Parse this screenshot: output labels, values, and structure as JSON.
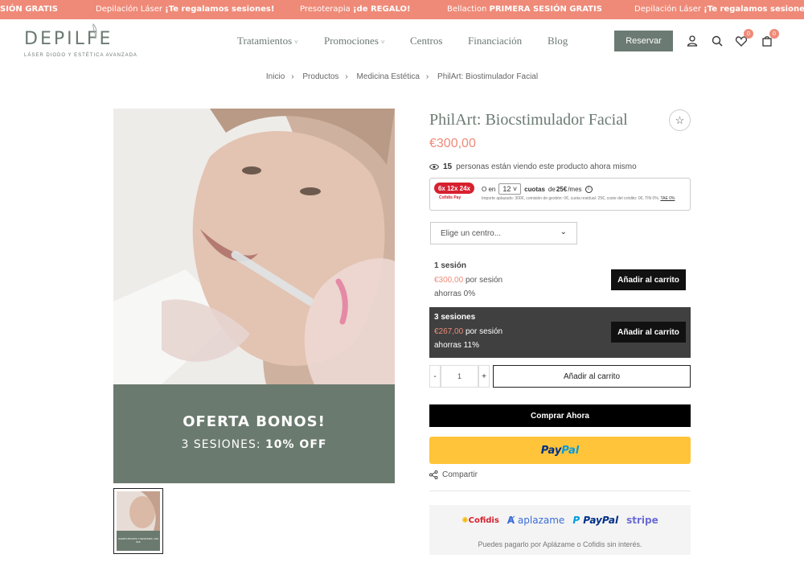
{
  "promo_bar": {
    "items": [
      {
        "text": "SIÓN GRATIS",
        "bold": ""
      },
      {
        "text": "Depilación Láser ",
        "bold": "¡Te regalamos sesiones!"
      },
      {
        "text": "Presoterapia ",
        "bold": "¡de REGALO!"
      },
      {
        "text": "Bellaction ",
        "bold": "PRIMERA SESIÓN GRATIS"
      },
      {
        "text": "Depilación Láser ",
        "bold": "¡Te regalamos sesiones!"
      }
    ]
  },
  "header": {
    "logo_text": "DEPILFE",
    "logo_tagline": "LÁSER DIODO Y ESTÉTICA AVANZADA",
    "nav": [
      "Tratamientos",
      "Promociones",
      "Centros",
      "Financiación",
      "Blog"
    ],
    "reserve_label": "Reservar",
    "wishlist_count": "0",
    "cart_count": "0"
  },
  "breadcrumb": [
    "Inicio",
    "Productos",
    "Medicina Estética",
    "PhilArt: Biostimulador Facial"
  ],
  "product": {
    "title": "PhilArt: Biocstimulador Facial",
    "price": "€300,00",
    "viewing_count": "15",
    "viewing_text": "personas están viendo este producto ahora mismo",
    "image_banner_line1": "OFERTA BONOS!",
    "image_banner_line2": "3 SESIONES: ",
    "image_banner_bold": "10% OFF",
    "thumb_text": "OFERTA BONOS! 3 SESIONES: 10% OFF"
  },
  "cofidis": {
    "badge": "6x 12x 24x",
    "brand": "Cofidis Pay",
    "o_en": "O en",
    "months": "12",
    "cuotas_label": "cuotas",
    "cuotas_de": "de",
    "cuota_amount": "25€",
    "per_month": "/mes",
    "fine_print": "Importe aplazado: 300€, comisión de gestión: 0€, cuota residual: 25€, coste del crédito: 0€, TIN 0%.",
    "tae": "TAE 0%"
  },
  "centro_select": {
    "placeholder": "Elige un centro..."
  },
  "options": [
    {
      "name": "1 sesión",
      "price": "€300,00",
      "per": "por sesión",
      "save": "ahorras 0%",
      "button": "Añadir al carrito"
    },
    {
      "name": "3 sesiones",
      "price": "€267,00",
      "per": "por sesión",
      "save": "ahorras 11%",
      "button": "Añadir al carrito"
    }
  ],
  "quantity": {
    "minus": "-",
    "value": "1",
    "plus": "+"
  },
  "add_to_cart_label": "Añadir al carrito",
  "buy_now_label": "Comprar Ahora",
  "paypal_label": {
    "part1": "Pay",
    "part2": "Pal"
  },
  "share_label": "Compartir",
  "payment_methods": {
    "logos": [
      "Cofidis",
      "aplazame",
      "PayPal",
      "stripe"
    ],
    "note": "Puedes pagarlo por Aplázame o Cofidis sin interés."
  },
  "colors": {
    "promo_bg": "#ef8a78",
    "brand_green": "#6b7a72",
    "price_pink": "#ef8a78",
    "paypal_yellow": "#ffc439"
  }
}
